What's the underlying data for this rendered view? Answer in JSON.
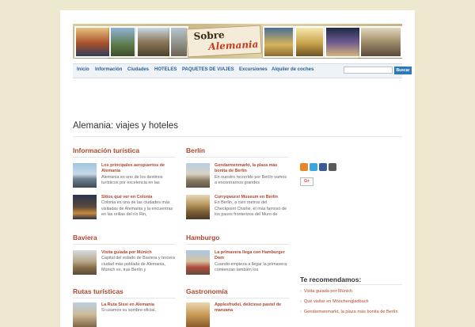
{
  "header": {
    "logo_line1": "Sobre",
    "logo_line2": "Alemania"
  },
  "nav": {
    "items": [
      "Inicio",
      "Información",
      "Ciudades",
      "HOTELES",
      "PAQUETES DE VIAJES",
      "Excursiones",
      "Alquiler de coches"
    ],
    "search_placeholder": "",
    "search_button": "Buscar"
  },
  "main": {
    "page_title": "Alemania: viajes y hoteles",
    "sections": [
      {
        "title": "Información turística",
        "posts": [
          {
            "title": "Los principales aeropuertos de Alemania",
            "excerpt": "Alemania es uno de los destinos turísticos por excelencia en las"
          },
          {
            "title": "Sitios qué ver en Colonia",
            "excerpt": "Colonia es una de las ciudades más visitadas de Alemania y la encuentras en las orillas del río Rin,"
          }
        ]
      },
      {
        "title": "Berlín",
        "posts": [
          {
            "title": "Gendarmenmarkt, la plaza más bonita de Berlín",
            "excerpt": "En nuestro recorrido por Berlín vamos a encontrarnos grandes"
          },
          {
            "title": "Curryqwurst Museum en Berlín",
            "excerpt": "En Berlín, a cien metros del Checkpoint Charlie, el más famoso de los pasos fronterizos del Muro de"
          }
        ]
      },
      {
        "title": "Baviera",
        "posts": [
          {
            "title": "Visita guiada por Múnich",
            "excerpt": "Capital del estado de Baviera y tercera ciudad más poblada de Alemania, Múnich es, tras Berlín y"
          }
        ]
      },
      {
        "title": "Hamburgo",
        "posts": [
          {
            "title": "La primavera llega con Hamburger Dom",
            "excerpt": "Cuando empieza a llegar la primavera comienzan también los"
          }
        ]
      },
      {
        "title": "Rutas turísticas",
        "posts": [
          {
            "title": "La Ruta Sissi en Alemania",
            "excerpt": "Si usamos su sombre-oficial,"
          }
        ]
      },
      {
        "title": "Gastronomía",
        "posts": [
          {
            "title": "Applesfrudel, delicioso pastel de manzana",
            "excerpt": ""
          }
        ]
      }
    ]
  },
  "sidebar": {
    "social_icons": [
      "rss-icon",
      "twitter-icon",
      "facebook-icon",
      "googleplus-icon"
    ],
    "gplus_button": "G+",
    "recommend_title": "Te recomendamos:",
    "recommend_items": [
      "Visita guiada por Múnich",
      "Qué visitar en Mönchengladbach",
      "Gendarmenmarkt, la plaza más bonita de Berlín"
    ]
  },
  "colors": {
    "background": "#ece9cf",
    "accent_red": "#b0462e",
    "nav_text": "#2a5d97",
    "search_button": "#2e7ab8"
  }
}
